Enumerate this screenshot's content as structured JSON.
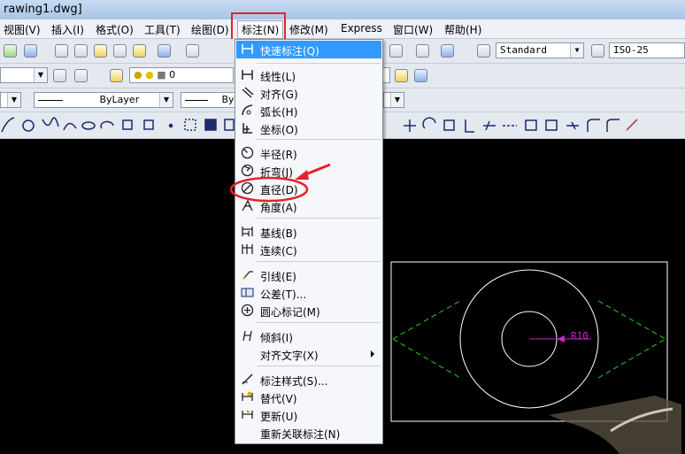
{
  "window": {
    "title": "rawing1.dwg]"
  },
  "menubar": {
    "items": [
      {
        "label": "视图(V)"
      },
      {
        "label": "插入(I)"
      },
      {
        "label": "格式(O)"
      },
      {
        "label": "工具(T)"
      },
      {
        "label": "绘图(D)"
      },
      {
        "label": "标注(N)"
      },
      {
        "label": "修改(M)"
      },
      {
        "label": "Express"
      },
      {
        "label": "窗口(W)"
      },
      {
        "label": "帮助(H)"
      }
    ],
    "active_index": 5
  },
  "toolbar": {
    "text_style": "Standard",
    "dim_style": "ISO-25",
    "layer_value": "0",
    "linetype": "ByLayer",
    "lineweight": "ByL"
  },
  "dimension_menu": {
    "items": [
      {
        "label": "快速标注(Q)",
        "icon": "quick-dimension-icon",
        "highlighted": true
      },
      {
        "label": "线性(L)",
        "icon": "linear-dimension-icon"
      },
      {
        "label": "对齐(G)",
        "icon": "aligned-dimension-icon"
      },
      {
        "label": "弧长(H)",
        "icon": "arc-length-icon"
      },
      {
        "label": "坐标(O)",
        "icon": "ordinate-icon"
      },
      {
        "label": "半径(R)",
        "icon": "radius-icon"
      },
      {
        "label": "折弯(J)",
        "icon": "jogged-icon"
      },
      {
        "label": "直径(D)",
        "icon": "diameter-icon"
      },
      {
        "label": "角度(A)",
        "icon": "angular-icon"
      },
      {
        "label": "基线(B)",
        "icon": "baseline-icon"
      },
      {
        "label": "连续(C)",
        "icon": "continue-icon"
      },
      {
        "label": "引线(E)",
        "icon": "leader-icon"
      },
      {
        "label": "公差(T)...",
        "icon": "tolerance-icon"
      },
      {
        "label": "圆心标记(M)",
        "icon": "center-mark-icon"
      },
      {
        "label": "倾斜(I)",
        "icon": "oblique-icon"
      },
      {
        "label": "对齐文字(X)",
        "icon": "",
        "submenu": true
      },
      {
        "label": "标注样式(S)...",
        "icon": "dim-style-icon"
      },
      {
        "label": "替代(V)",
        "icon": "override-icon"
      },
      {
        "label": "更新(U)",
        "icon": "update-icon"
      },
      {
        "label": "重新关联标注(N)",
        "icon": ""
      }
    ]
  },
  "drawing": {
    "dimension_text": "R10",
    "colors": {
      "circle": "#ffffff",
      "dashed": "#22cc22",
      "dimension": "#cc22cc",
      "annotation": "#e8202a"
    }
  }
}
